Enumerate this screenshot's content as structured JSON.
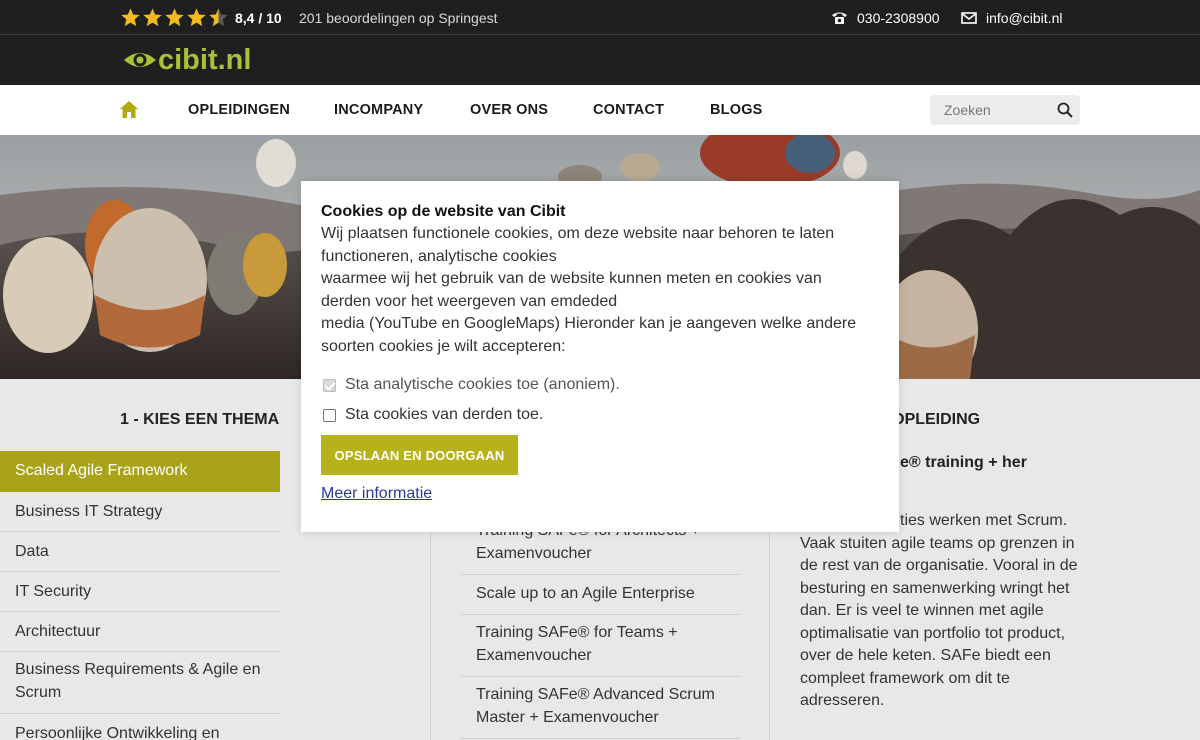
{
  "topbar": {
    "rating_stars": 4.5,
    "rating_score": "8,4 / 10",
    "rating_count": "201 beoordelingen op Springest",
    "phone": "030-2308900",
    "email": "info@cibit.nl",
    "star_color": "#f3b91e"
  },
  "logo": {
    "text": "cibit.nl",
    "color": "#a7c13a"
  },
  "nav": {
    "items": [
      "OPLEIDINGEN",
      "INCOMPANY",
      "OVER ONS",
      "CONTACT",
      "BLOGS"
    ],
    "search_placeholder": "Zoeken",
    "home_color": "#b2a90f"
  },
  "columns": {
    "theme_title": "1 - KIES EEN THEMA",
    "course_title_fragment": "E OPLEIDING",
    "themes": [
      "Scaled Agile Framework",
      "Business IT Strategy",
      "Data",
      "IT Security",
      "Architectuur",
      "Business Requirements & Agile en Scrum",
      "Persoonlijke Ontwikkeling en"
    ],
    "courses": [
      "Training SAFe® for Architects + Examenvoucher",
      "Scale up to an Agile Enterprise",
      "Training SAFe® for Teams + Examenvoucher",
      "Training SAFe® Advanced Scrum Master + Examenvoucher"
    ],
    "desc_title_fragment": "e® training + her",
    "desc_text": "ties werken met Scrum. Vaak stuiten agile teams op grenzen in de rest van de organisatie. Vooral in de besturing en samenwerking wringt het dan. Er is veel te winnen met agile optimalisatie van portfolio tot product, over de hele keten. SAFe biedt een compleet framework om dit te adresseren.",
    "active_color": "#a9a31a"
  },
  "modal": {
    "title": "Cookies op de website van Cibit",
    "body_lines": [
      "Wij plaatsen functionele cookies, om deze website naar behoren te laten",
      "functioneren, analytische cookies",
      "waarmee wij het gebruik van de website kunnen meten en cookies van",
      "derden voor het weergeven van emdeded",
      "media (YouTube en GoogleMaps) Hieronder kan je aangeven welke andere",
      "soorten cookies je wilt accepteren:"
    ],
    "checkbox_analytics": "Sta analytische cookies toe (anoniem).",
    "checkbox_third_party": "Sta cookies van derden toe.",
    "save_button": "OPSLAAN EN DOORGAAN",
    "more_info": "Meer informatie",
    "button_color": "#b7b219"
  }
}
